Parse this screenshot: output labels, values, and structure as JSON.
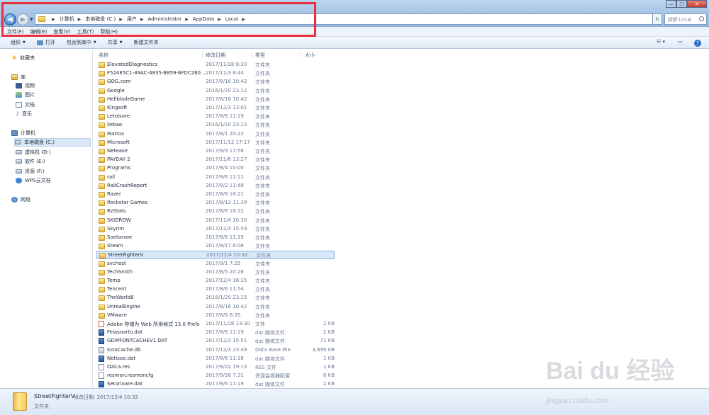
{
  "window": {
    "controls": [
      "—",
      "□",
      "✕"
    ]
  },
  "address_bar": {
    "breadcrumbs": [
      "计算机",
      "本地磁盘 (C:)",
      "用户",
      "Administrator",
      "AppData",
      "Local"
    ],
    "search_placeholder": "搜索 Local"
  },
  "menu": [
    "文件(F)",
    "编辑(E)",
    "查看(V)",
    "工具(T)",
    "帮助(H)"
  ],
  "toolbar": {
    "organize": "组织",
    "open": "打开",
    "include_in_library": "包含到库中",
    "share": "共享",
    "new_folder": "新建文件夹"
  },
  "sidebar": {
    "favorites": "收藏夹",
    "libraries": "库",
    "lib_items": [
      "视频",
      "图片",
      "文档",
      "音乐"
    ],
    "computer": "计算机",
    "drives": [
      "本地磁盘 (C:)",
      "虚拟机 (D:)",
      "软件 (E:)",
      "资源 (F:)",
      "WPS云文档"
    ],
    "network": "网络"
  },
  "columns": {
    "name": "名称",
    "date": "修改日期",
    "type": "类型",
    "size": "大小"
  },
  "files": [
    {
      "name": "ElevatedDiagnostics",
      "date": "2017/11/28 8:30",
      "type": "文件夹",
      "size": "",
      "icon": "folder"
    },
    {
      "name": "F524E5C1-49AC-4835-B859-6FDC260...",
      "date": "2017/11/3 8:44",
      "type": "文件夹",
      "size": "",
      "icon": "folder"
    },
    {
      "name": "GOG.com",
      "date": "2017/8/16 10:42",
      "type": "文件夹",
      "size": "",
      "icon": "folder"
    },
    {
      "name": "Google",
      "date": "2016/1/20 23:12",
      "type": "文件夹",
      "size": "",
      "icon": "folder"
    },
    {
      "name": "HellbladeGame",
      "date": "2017/8/16 10:42",
      "type": "文件夹",
      "size": "",
      "icon": "folder"
    },
    {
      "name": "Kingsoft",
      "date": "2017/12/3 13:01",
      "type": "文件夹",
      "size": "",
      "icon": "folder"
    },
    {
      "name": "Letoisore",
      "date": "2017/8/6 11:19",
      "type": "文件夹",
      "size": "",
      "icon": "folder"
    },
    {
      "name": "liebao",
      "date": "2016/1/20 23:13",
      "type": "文件夹",
      "size": "",
      "icon": "folder"
    },
    {
      "name": "Matrox",
      "date": "2017/8/1 20:23",
      "type": "文件夹",
      "size": "",
      "icon": "folder"
    },
    {
      "name": "Microsoft",
      "date": "2017/11/12 17:17",
      "type": "文件夹",
      "size": "",
      "icon": "folder"
    },
    {
      "name": "Netease",
      "date": "2017/9/3 17:58",
      "type": "文件夹",
      "size": "",
      "icon": "folder"
    },
    {
      "name": "PAYDAY 2",
      "date": "2017/11/6 13:27",
      "type": "文件夹",
      "size": "",
      "icon": "folder"
    },
    {
      "name": "Programs",
      "date": "2017/8/4 10:00",
      "type": "文件夹",
      "size": "",
      "icon": "folder"
    },
    {
      "name": "rail",
      "date": "2017/8/6 11:11",
      "type": "文件夹",
      "size": "",
      "icon": "folder"
    },
    {
      "name": "RailCrashReport",
      "date": "2017/8/2 11:48",
      "type": "文件夹",
      "size": "",
      "icon": "folder"
    },
    {
      "name": "Razer",
      "date": "2017/8/8 18:21",
      "type": "文件夹",
      "size": "",
      "icon": "folder"
    },
    {
      "name": "Rockstar Games",
      "date": "2017/8/13 11:39",
      "type": "文件夹",
      "size": "",
      "icon": "folder"
    },
    {
      "name": "RzStats",
      "date": "2017/8/8 18:22",
      "type": "文件夹",
      "size": "",
      "icon": "folder"
    },
    {
      "name": "SKIDROW",
      "date": "2017/11/4 20:30",
      "type": "文件夹",
      "size": "",
      "icon": "folder"
    },
    {
      "name": "Skyrim",
      "date": "2017/12/3 15:59",
      "type": "文件夹",
      "size": "",
      "icon": "folder"
    },
    {
      "name": "Soetarsoe",
      "date": "2017/8/6 11:19",
      "type": "文件夹",
      "size": "",
      "icon": "folder"
    },
    {
      "name": "Steam",
      "date": "2017/8/17 6:06",
      "type": "文件夹",
      "size": "",
      "icon": "folder"
    },
    {
      "name": "StreetFighterV",
      "date": "2017/12/4 10:32",
      "type": "文件夹",
      "size": "",
      "icon": "folder",
      "selected": true
    },
    {
      "name": "svchost",
      "date": "2017/9/1 7:25",
      "type": "文件夹",
      "size": "",
      "icon": "folder"
    },
    {
      "name": "TechSmith",
      "date": "2017/8/5 20:26",
      "type": "文件夹",
      "size": "",
      "icon": "folder"
    },
    {
      "name": "Temp",
      "date": "2017/12/4 16:15",
      "type": "文件夹",
      "size": "",
      "icon": "folder"
    },
    {
      "name": "Tencent",
      "date": "2017/8/6 11:54",
      "type": "文件夹",
      "size": "",
      "icon": "folder"
    },
    {
      "name": "TheWorld6",
      "date": "2016/1/20 23:15",
      "type": "文件夹",
      "size": "",
      "icon": "folder"
    },
    {
      "name": "UnrealEngine",
      "date": "2017/8/16 10:42",
      "type": "文件夹",
      "size": "",
      "icon": "folder"
    },
    {
      "name": "VMware",
      "date": "2017/8/8 6:35",
      "type": "文件夹",
      "size": "",
      "icon": "folder"
    },
    {
      "name": "Adobe 存储为 Web 所用格式 13.0 Prefs",
      "date": "2017/11/28 13:30",
      "type": "文件",
      "size": "2 KB",
      "icon": "app"
    },
    {
      "name": "Feiasoarto.dat",
      "date": "2017/8/6 11:19",
      "type": "dat 媒体文件",
      "size": "2 KB",
      "icon": "dat"
    },
    {
      "name": "GDIPFONTCACHEV1.DAT",
      "date": "2017/12/3 15:51",
      "type": "dat 媒体文件",
      "size": "71 KB",
      "icon": "dat"
    },
    {
      "name": "IconCache.db",
      "date": "2017/12/3 23:49",
      "type": "Data Base File",
      "size": "3,699 KB",
      "icon": "db"
    },
    {
      "name": "Netisoe.dat",
      "date": "2017/8/6 11:18",
      "type": "dat 媒体文件",
      "size": "1 KB",
      "icon": "dat"
    },
    {
      "name": "Ozica.res",
      "date": "2017/8/22 19:13",
      "type": "RES 文件",
      "size": "1 KB",
      "icon": "file"
    },
    {
      "name": "resmon.resmoncfg",
      "date": "2017/9/26 7:31",
      "type": "资源监视器配置",
      "size": "8 KB",
      "icon": "file"
    },
    {
      "name": "Setorioare.dat",
      "date": "2017/8/6 11:19",
      "type": "dat 媒体文件",
      "size": "2 KB",
      "icon": "dat"
    }
  ],
  "details": {
    "name": "StreetFighterV",
    "modified": "修改日期: 2017/12/4 10:32",
    "type": "文件夹"
  },
  "watermark": {
    "main": "Bai du 经验",
    "sub": "jingyan.baidu.com"
  },
  "colors": {
    "highlight_box": "#e9303f",
    "selection": "#d9e7f8",
    "folder": "#f5cd62"
  }
}
